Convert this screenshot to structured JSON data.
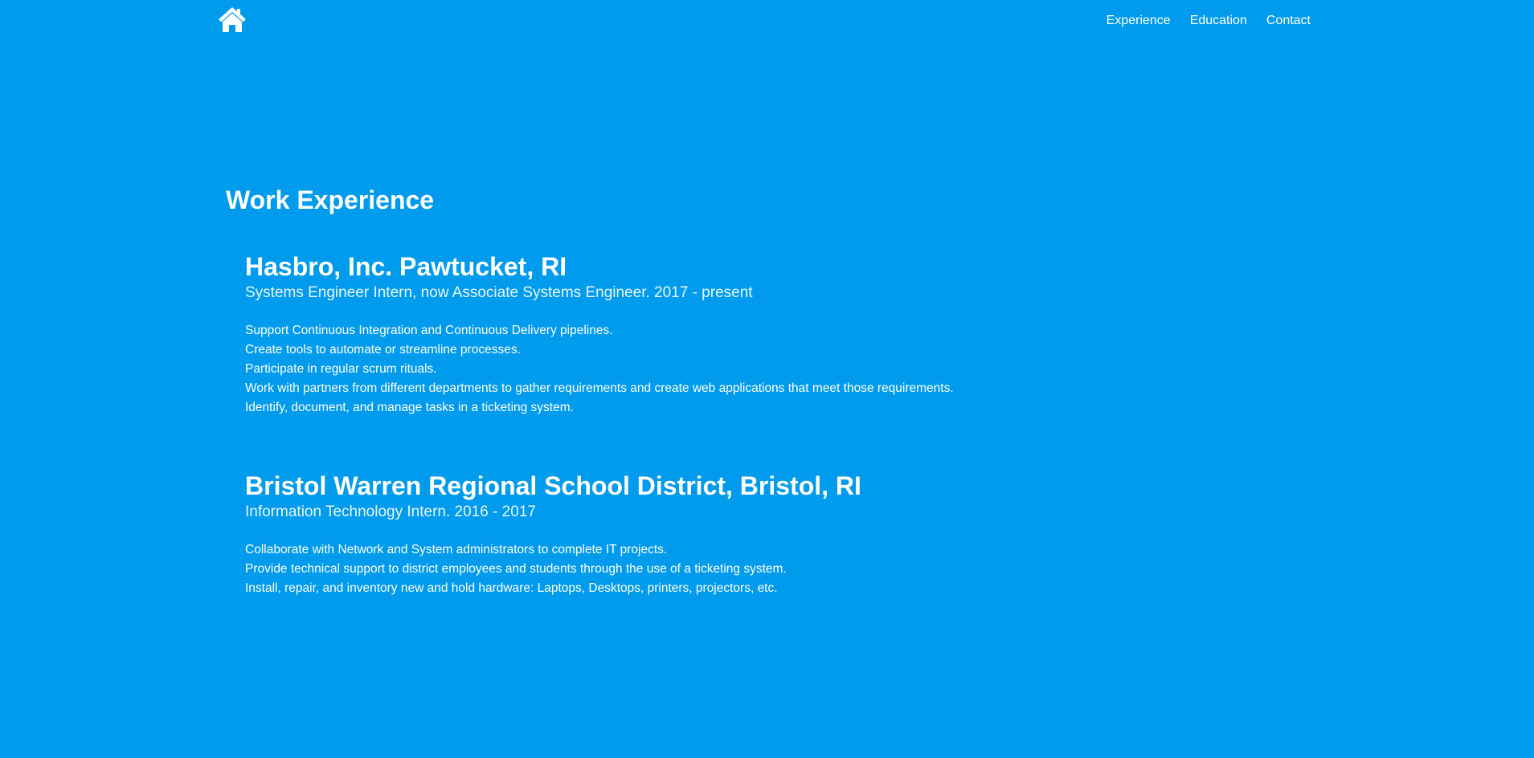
{
  "header": {
    "home_icon": "home-icon",
    "nav": [
      {
        "label": "Experience"
      },
      {
        "label": "Education"
      },
      {
        "label": "Contact"
      }
    ]
  },
  "main": {
    "section_title": "Work Experience",
    "jobs": [
      {
        "title": "Hasbro, Inc. Pawtucket, RI",
        "subtitle": "Systems Engineer Intern, now Associate Systems Engineer. 2017 - present",
        "duties": [
          "Support Continuous Integration and Continuous Delivery pipelines.",
          "Create tools to automate or streamline processes.",
          "Participate in regular scrum rituals.",
          "Work with partners from different departments to gather requirements and create web applications that meet those requirements.",
          "Identify, document, and manage tasks in a ticketing system."
        ]
      },
      {
        "title": "Bristol Warren Regional School District, Bristol, RI",
        "subtitle": "Information Technology Intern. 2016 - 2017",
        "duties": [
          "Collaborate with Network and System administrators to complete IT projects.",
          "Provide technical support to district employees and students through the use of a ticketing system.",
          "Install, repair, and inventory new and hold hardware: Laptops, Desktops, printers, projectors, etc."
        ]
      }
    ]
  },
  "colors": {
    "background": "#009bec",
    "text": "#ffffff"
  }
}
